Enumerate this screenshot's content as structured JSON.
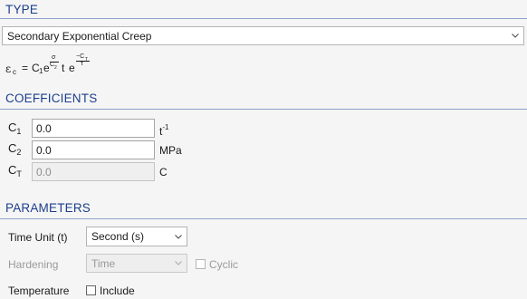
{
  "type_section": {
    "title": "TYPE",
    "model_select": {
      "value": "Secondary Exponential Creep"
    }
  },
  "formula": {
    "lhs_symbol": "ε",
    "lhs_subscript": "c",
    "equals": "=",
    "c1": "C",
    "c1_sub": "1",
    "e": "e",
    "num": "σ",
    "den": "C",
    "den_sub": "2",
    "t": "t",
    "e2": "e",
    "exp_num": "−C",
    "exp_num_sub": "T",
    "exp_den": "τ"
  },
  "coefficients": {
    "title": "COEFFICIENTS",
    "rows": [
      {
        "symbol": "C",
        "sub": "1",
        "value": "0.0",
        "unit_base": "t",
        "unit_sup": "-1",
        "disabled": false
      },
      {
        "symbol": "C",
        "sub": "2",
        "value": "0.0",
        "unit_base": "MPa",
        "unit_sup": "",
        "disabled": false
      },
      {
        "symbol": "C",
        "sub": "T",
        "value": "0.0",
        "unit_base": "C",
        "unit_sup": "",
        "disabled": true
      }
    ]
  },
  "parameters": {
    "title": "PARAMETERS",
    "time_unit": {
      "label": "Time Unit (t)",
      "value": "Second (s)"
    },
    "hardening": {
      "label": "Hardening",
      "value": "Time",
      "cyclic_label": "Cyclic",
      "cyclic_checked": false
    },
    "temperature": {
      "label": "Temperature",
      "include_label": "Include",
      "include_checked": false
    }
  }
}
